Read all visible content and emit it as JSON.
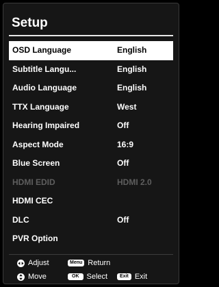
{
  "title": "Setup",
  "menu": [
    {
      "label": "OSD Language",
      "value": "English",
      "state": "selected"
    },
    {
      "label": "Subtitle Langu...",
      "value": "English",
      "state": "normal"
    },
    {
      "label": "Audio Language",
      "value": "English",
      "state": "normal"
    },
    {
      "label": "TTX Language",
      "value": "West",
      "state": "normal"
    },
    {
      "label": "Hearing Impaired",
      "value": "Off",
      "state": "normal"
    },
    {
      "label": "Aspect Mode",
      "value": "16:9",
      "state": "normal"
    },
    {
      "label": "Blue Screen",
      "value": "Off",
      "state": "normal"
    },
    {
      "label": "HDMI EDID",
      "value": "HDMI 2.0",
      "state": "disabled"
    },
    {
      "label": "HDMI CEC",
      "value": "",
      "state": "normal"
    },
    {
      "label": "DLC",
      "value": "Off",
      "state": "normal"
    },
    {
      "label": "PVR Option",
      "value": "",
      "state": "normal"
    }
  ],
  "footer": {
    "adjust_label": "Adjust",
    "adjust_icon": "left-right-arrows-icon",
    "menu_key": "Menu",
    "return_label": "Return",
    "move_label": "Move",
    "move_icon": "up-down-arrows-icon",
    "ok_key": "OK",
    "select_label": "Select",
    "exit_key": "Exit",
    "exit_label": "Exit"
  },
  "colors": {
    "background": "#161616",
    "selected_bg": "#ffffff",
    "selected_text": "#000000",
    "text": "#ffffff",
    "disabled_text": "#5e5e5e"
  }
}
